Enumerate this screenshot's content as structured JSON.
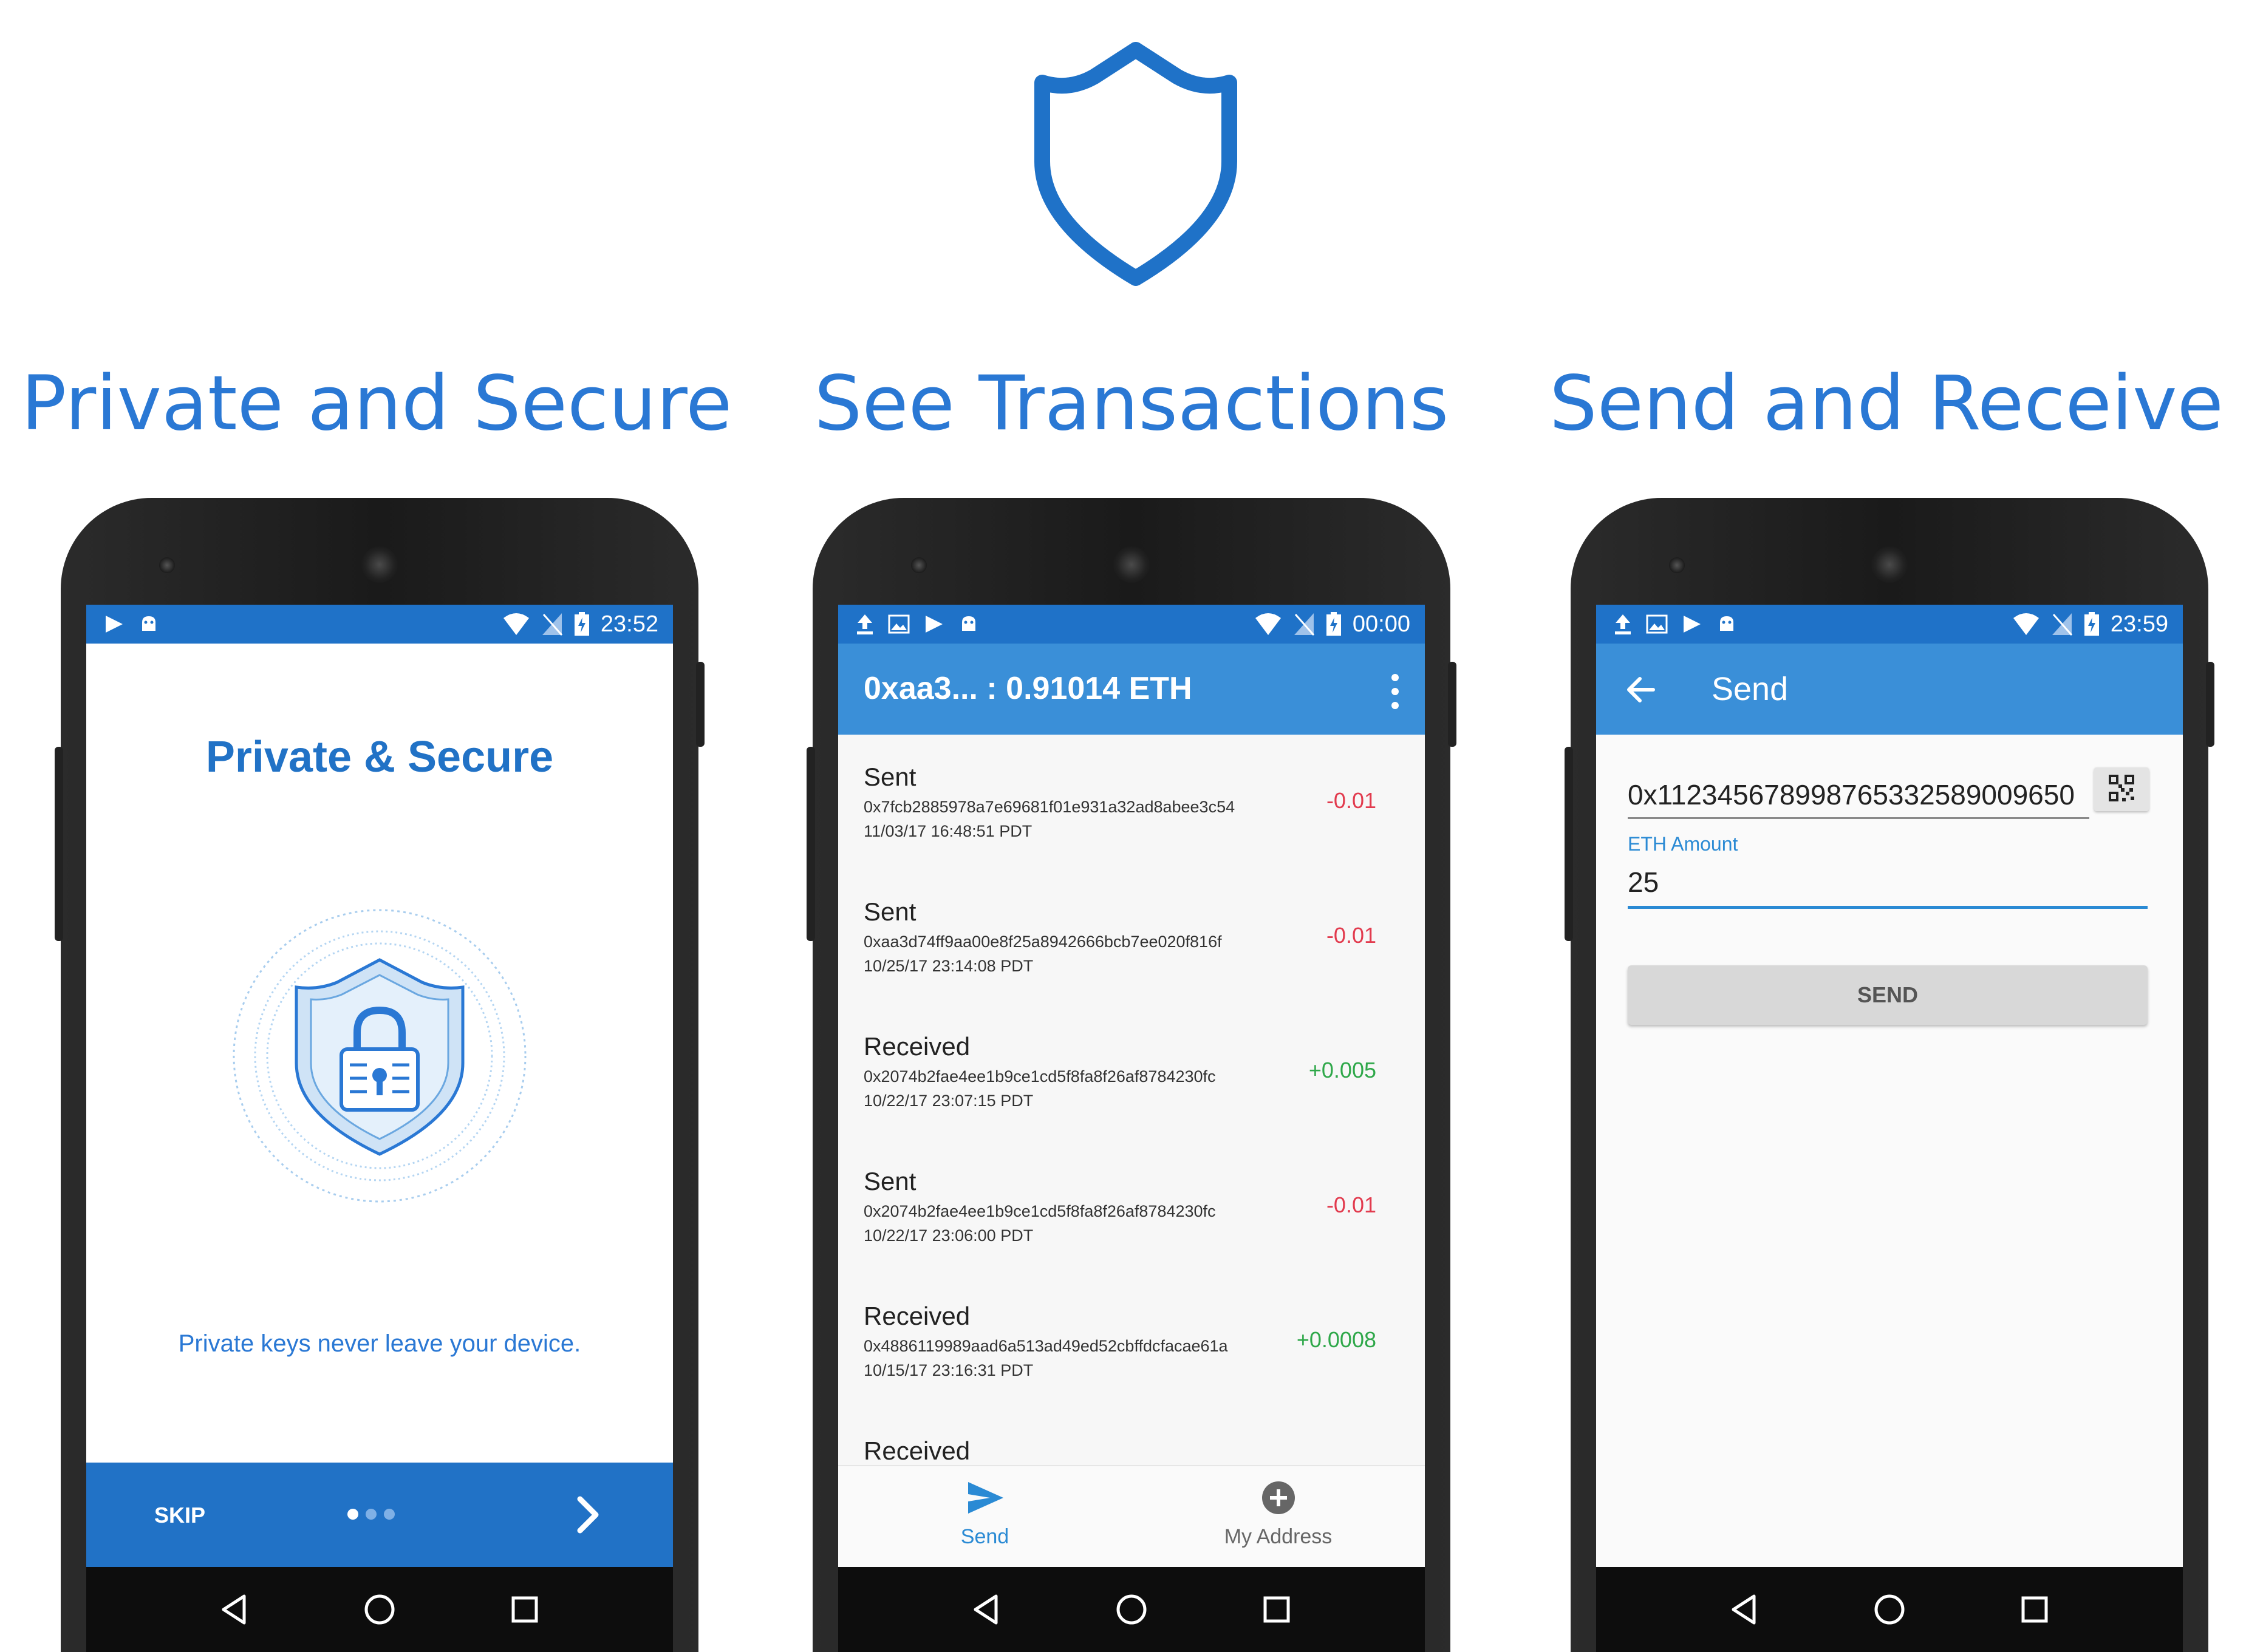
{
  "colors": {
    "brand_blue": "#2a78d4",
    "statusbar_blue": "#1f72c8",
    "toolbar_blue": "#3a8fd8",
    "sent_red": "#e23b4e",
    "received_green": "#2fa84a"
  },
  "logo_icon": "shield-icon",
  "headlines": [
    "Private and Secure",
    "See Transactions",
    "Send and Receive"
  ],
  "phone1": {
    "status_time": "23:52",
    "title": "Private & Secure",
    "caption": "Private keys never leave your device.",
    "skip_label": "SKIP",
    "pager": {
      "total": 3,
      "current": 1
    }
  },
  "phone2": {
    "status_time": "00:00",
    "toolbar_title": "0xaa3... : 0.91014 ETH",
    "transactions": [
      {
        "type": "Sent",
        "hash": "0x7fcb2885978a7e69681f01e931a32ad8abee3c54",
        "date": "11/03/17 16:48:51 PDT",
        "amount": "-0.01"
      },
      {
        "type": "Sent",
        "hash": "0xaa3d74ff9aa00e8f25a8942666bcb7ee020f816f",
        "date": "10/25/17 23:14:08 PDT",
        "amount": "-0.01"
      },
      {
        "type": "Received",
        "hash": "0x2074b2fae4ee1b9ce1cd5f8fa8f26af8784230fc",
        "date": "10/22/17 23:07:15 PDT",
        "amount": "+0.005"
      },
      {
        "type": "Sent",
        "hash": "0x2074b2fae4ee1b9ce1cd5f8fa8f26af8784230fc",
        "date": "10/22/17 23:06:00 PDT",
        "amount": "-0.01"
      },
      {
        "type": "Received",
        "hash": "0x4886119989aad6a513ad49ed52cbffdcfacae61a",
        "date": "10/15/17 23:16:31 PDT",
        "amount": "+0.0008"
      },
      {
        "type": "Received",
        "hash": "",
        "date": "",
        "amount": ""
      }
    ],
    "bottom_nav": {
      "send_label": "Send",
      "address_label": "My Address"
    }
  },
  "phone3": {
    "status_time": "23:59",
    "toolbar_title": "Send",
    "address_value": "0x112345678998765332589009650",
    "amount_label": "ETH Amount",
    "amount_value": "25",
    "send_button": "SEND"
  }
}
